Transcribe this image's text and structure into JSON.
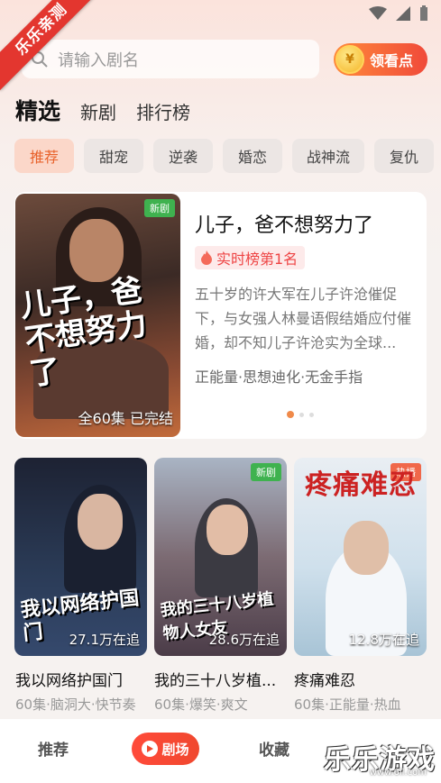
{
  "watermark_ribbon": "乐乐亲测",
  "search": {
    "placeholder": "请输入剧名"
  },
  "coin_button": {
    "label": "领看点",
    "coin_symbol": "¥"
  },
  "top_tabs": [
    {
      "label": "精选",
      "active": true
    },
    {
      "label": "新剧"
    },
    {
      "label": "排行榜"
    }
  ],
  "categories": [
    {
      "label": "推荐",
      "active": true
    },
    {
      "label": "甜宠"
    },
    {
      "label": "逆袭"
    },
    {
      "label": "婚恋"
    },
    {
      "label": "战神流"
    },
    {
      "label": "复仇"
    }
  ],
  "featured": {
    "badge": "新剧",
    "poster_title": "儿子，爸不想努力了",
    "episodes": "全60集  已完结",
    "title": "儿子，爸不想努力了",
    "rank": "实时榜第1名",
    "description": "五十岁的许大军在儿子许沧催促下，与女强人林曼语假结婚应付催婚，却不知儿子许沧实为全球...",
    "tags": "正能量·思想迪化·无金手指"
  },
  "grid": [
    {
      "poster_title": "我以网络护国门",
      "watching": "27.1万在追",
      "badge": "",
      "name": "我以网络护国门",
      "sub": "60集·脑洞大·快节奏"
    },
    {
      "poster_title": "我的三十八岁植物人女友",
      "watching": "28.6万在追",
      "badge": "新剧",
      "name": "我的三十八岁植...",
      "sub": "60集·爆笑·爽文"
    },
    {
      "poster_title": "疼痛难忍",
      "watching": "12.8万在追",
      "badge": "热播",
      "name": "疼痛难忍",
      "sub": "60集·正能量·热血"
    }
  ],
  "bottom_nav": [
    {
      "label": "推荐"
    },
    {
      "label": "剧场",
      "active": true
    },
    {
      "label": "收藏"
    }
  ],
  "corner_watermark": {
    "text": "乐乐游戏",
    "url": "www.6ll.com"
  },
  "colors": {
    "accent": "#f0482e",
    "chip_active_bg": "#fbd7c9",
    "badge_new": "#3fb24f",
    "badge_hot": "#f0684a"
  }
}
